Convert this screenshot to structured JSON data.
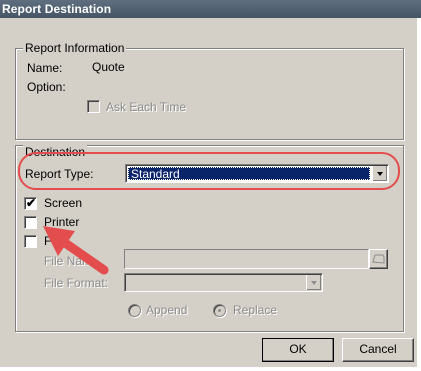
{
  "window": {
    "title": "Report Destination"
  },
  "report_information": {
    "legend": "Report Information",
    "name_label": "Name:",
    "name_value": "Quote",
    "option_label": "Option:",
    "ask_each_time_label": "Ask Each Time",
    "ask_each_time_checked": false
  },
  "destination": {
    "legend": "Destination",
    "report_type_label": "Report Type:",
    "report_type_value": "Standard",
    "screen_label": "Screen",
    "screen_checked": true,
    "printer_label": "Printer",
    "printer_checked": false,
    "file_label": "F",
    "file_checked": false,
    "file_name_label": "File Nam",
    "file_name_value": "",
    "file_format_label": "File Format:",
    "file_format_value": "",
    "append_label": "Append",
    "replace_label": "Replace",
    "write_mode_selected": "Replace"
  },
  "buttons": {
    "ok_label": "OK",
    "cancel_label": "Cancel"
  },
  "annotation": {
    "color": "#e34d4d",
    "pointer_icon": "red-arrow-icon"
  },
  "colors": {
    "dialog_bg": "#d4d0c8",
    "selection": "#0a246a",
    "titlebar": "#4f5f6f"
  }
}
